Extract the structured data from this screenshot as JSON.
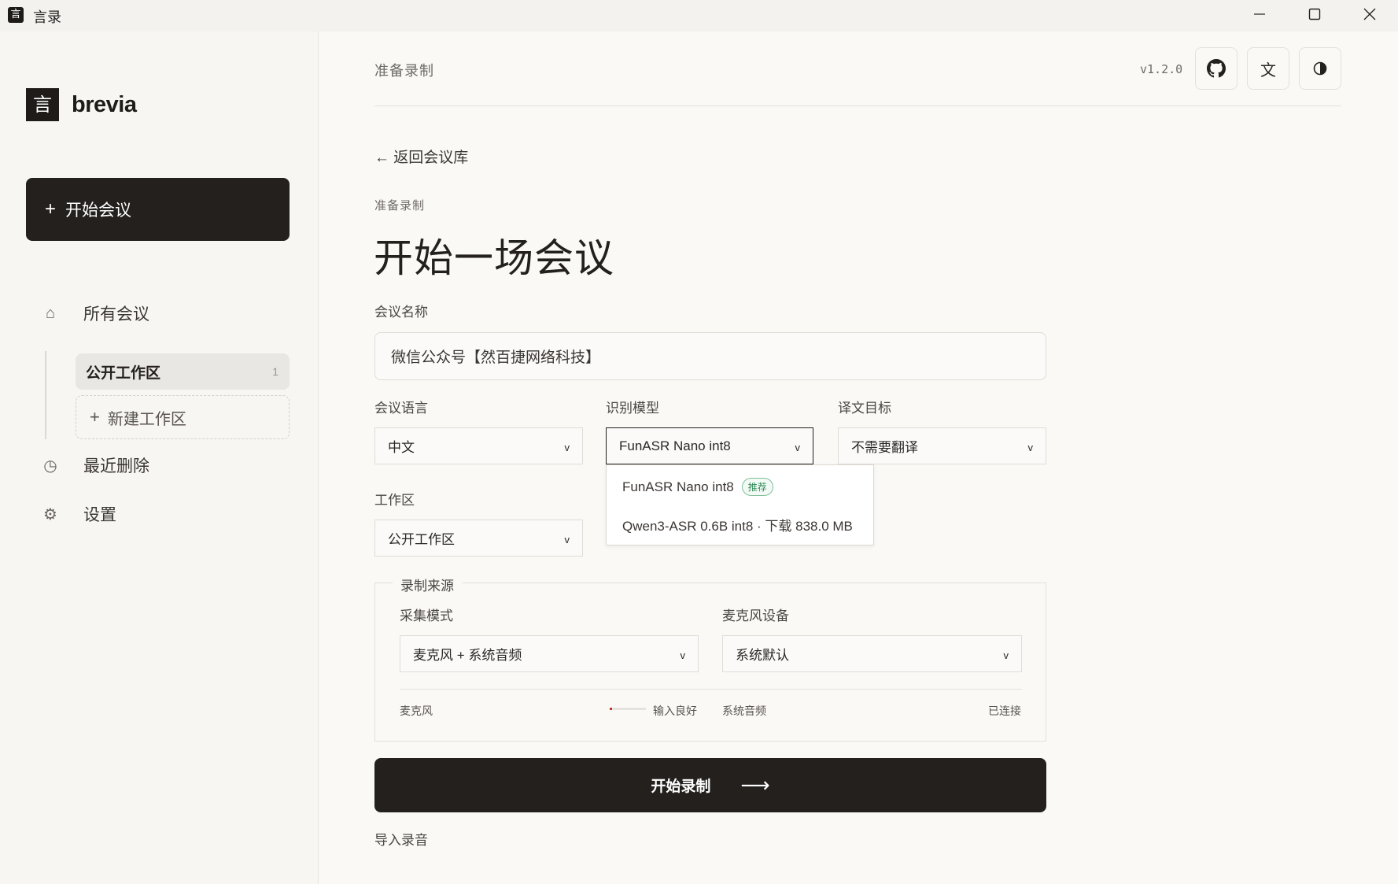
{
  "window": {
    "logo_glyph": "言",
    "title": "言录"
  },
  "sidebar": {
    "brand_glyph": "言",
    "brand_name": "brevia",
    "new_meeting": "开始会议",
    "nav": {
      "all": "所有会议",
      "recent_deleted": "最近删除",
      "settings": "设置"
    },
    "workspaces": {
      "active_name": "公开工作区",
      "active_count": "1",
      "new_label": "新建工作区"
    }
  },
  "header": {
    "title": "准备录制",
    "version": "v1.2.0",
    "lang_toggle": "文"
  },
  "main": {
    "back_link": "← 返回会议库",
    "eyebrow": "准备录制",
    "page_title": "开始一场会议",
    "meeting_name": {
      "label": "会议名称",
      "value": "微信公众号【然百捷网络科技】"
    },
    "language": {
      "label": "会议语言",
      "value": "中文"
    },
    "model": {
      "label": "识别模型",
      "value": "FunASR Nano int8",
      "options": [
        {
          "label": "FunASR Nano int8",
          "badge": "推荐"
        },
        {
          "label": "Qwen3-ASR 0.6B int8 · 下载 838.0 MB"
        }
      ]
    },
    "translation": {
      "label": "译文目标",
      "value": "不需要翻译"
    },
    "workspace": {
      "label": "工作区",
      "value": "公开工作区"
    },
    "source": {
      "legend": "录制来源",
      "mode_label": "采集模式",
      "mode_value": "麦克风 + 系统音频",
      "mic_device_label": "麦克风设备",
      "mic_device_value": "系统默认",
      "mic_label": "麦克风",
      "mic_status": "输入良好",
      "mic_level": 0.06,
      "system_label": "系统音频",
      "system_status": "已连接"
    },
    "start_button": "开始录制",
    "import_link": "导入录音"
  },
  "colors": {
    "primary_dark": "#24201e",
    "background": "#faf9f6",
    "sidebar_bg": "#f7f6f2",
    "badge_green": "#2e8b57",
    "meter_red": "#c0392b"
  }
}
